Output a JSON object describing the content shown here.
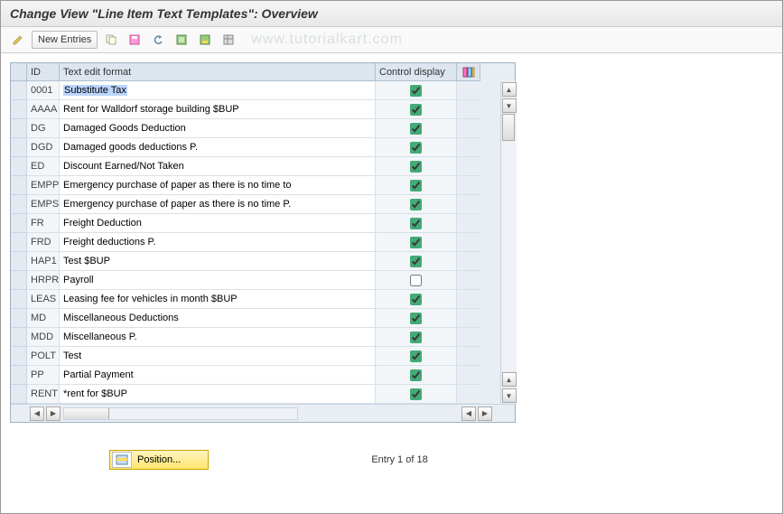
{
  "title": "Change View \"Line Item Text Templates\": Overview",
  "toolbar": {
    "new_entries": "New Entries"
  },
  "watermark": "www.tutorialkart.com",
  "columns": {
    "id": "ID",
    "text": "Text edit format",
    "ctrl": "Control display"
  },
  "rows": [
    {
      "id": "0001",
      "text": "Substitute Tax",
      "ctrl": true,
      "sel": true
    },
    {
      "id": "AAAA",
      "text": "Rent for Walldorf storage building $BUP",
      "ctrl": true
    },
    {
      "id": "DG",
      "text": "Damaged Goods Deduction",
      "ctrl": true
    },
    {
      "id": "DGD",
      "text": "Damaged goods deductions P.",
      "ctrl": true
    },
    {
      "id": "ED",
      "text": "Discount Earned/Not Taken",
      "ctrl": true
    },
    {
      "id": "EMPP",
      "text": "Emergency purchase of paper as there is no time to",
      "ctrl": true
    },
    {
      "id": "EMPS",
      "text": "Emergency purchase of paper as there is no time P.",
      "ctrl": true
    },
    {
      "id": "FR",
      "text": "Freight Deduction",
      "ctrl": true
    },
    {
      "id": "FRD",
      "text": "Freight deductions P.",
      "ctrl": true
    },
    {
      "id": "HAP1",
      "text": "Test $BUP",
      "ctrl": true
    },
    {
      "id": "HRPR",
      "text": "Payroll",
      "ctrl": false
    },
    {
      "id": "LEAS",
      "text": "Leasing fee for vehicles in month $BUP",
      "ctrl": true
    },
    {
      "id": "MD",
      "text": "Miscellaneous Deductions",
      "ctrl": true
    },
    {
      "id": "MDD",
      "text": "Miscellaneous P.",
      "ctrl": true
    },
    {
      "id": "POLT",
      "text": "Test",
      "ctrl": true
    },
    {
      "id": "PP",
      "text": "Partial Payment",
      "ctrl": true
    },
    {
      "id": "RENT",
      "text": "*rent for $BUP",
      "ctrl": true
    }
  ],
  "footer": {
    "position": "Position...",
    "entry": "Entry 1 of 18"
  }
}
